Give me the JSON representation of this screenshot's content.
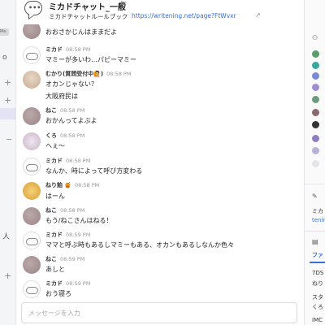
{
  "header": {
    "title": "ミカドチャット_一般",
    "title_icon": "link-icon",
    "description_label": "ミカドチャットルールブック",
    "description_link": "https://writening.net/page?FtWvxr",
    "edit_icon": "external-link-icon"
  },
  "left_sidebar": {
    "me_badge": "Me",
    "markers": [
      "o",
      "+",
      "+",
      "−",
      "人",
      "+"
    ]
  },
  "messages": [
    {
      "author": "",
      "time": "",
      "text": "おおさかじんはままだよ",
      "avatar": "neko"
    },
    {
      "author": "ミカド",
      "time": "08:58 PM",
      "text": "マミーが多いわ…パピーマミー",
      "avatar": "mikado"
    },
    {
      "author": "むかり(質問受付中",
      "badge": "🙋",
      "author_suffix": ")",
      "time": "08:58 PM",
      "text": "オカンじゃない？",
      "text2": "大阪府民は",
      "avatar": "mukai"
    },
    {
      "author": "ねこ",
      "time": "08:58 PM",
      "text": "おかんってよぶよ",
      "avatar": "neko"
    },
    {
      "author": "くろ",
      "time": "08:58 PM",
      "text": "へぇ～",
      "avatar": "kuro"
    },
    {
      "author": "ミカド",
      "time": "08:58 PM",
      "text": "なんか、時によって呼び方変わる",
      "avatar": "mikado"
    },
    {
      "author": "ねり飴",
      "badge": "🍯",
      "time": "08:58 PM",
      "text": "はーん",
      "avatar": "neriame"
    },
    {
      "author": "ねこ",
      "time": "08:58 PM",
      "text": "もう/ねこさんはねる！",
      "avatar": "neko"
    },
    {
      "author": "ミカド",
      "time": "08:59 PM",
      "text": "ママと呼ぶ時もあるしマミーもある、オカンもあるしなんか色々",
      "avatar": "mikado"
    },
    {
      "author": "ねこ",
      "time": "08:59 PM",
      "text": "あしと",
      "avatar": "neko"
    },
    {
      "author": "ミカド",
      "time": "08:59 PM",
      "text": "おう寝ろ",
      "avatar": "mikado"
    }
  ],
  "composer": {
    "placeholder": "メッセージを入力"
  },
  "right_sidebar": {
    "members_icon": "members-icon",
    "pin_icon": "pin-icon",
    "text_1": "ミカ",
    "text_2": "tenin",
    "file_icon": "file-icon",
    "tab_label": "ファ",
    "item_1": "7DS",
    "item_2": "ねり",
    "item_3": "スタ",
    "item_4": "くろ",
    "item_5": "IMC",
    "colors": {
      "link": "#3a6fd8",
      "accent": "#5b5fc7"
    }
  }
}
